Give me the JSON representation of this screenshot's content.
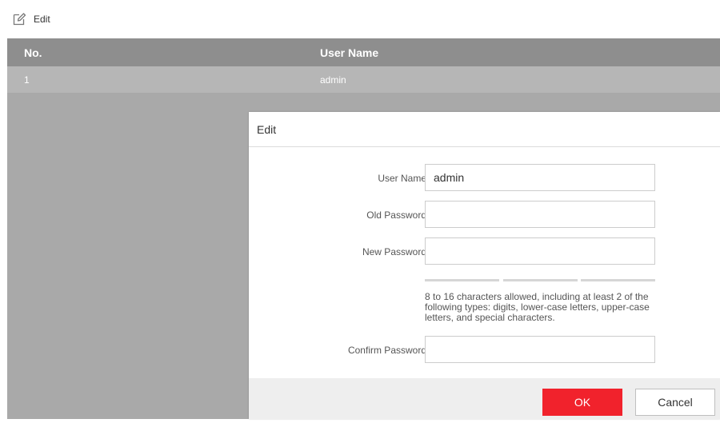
{
  "toolbar": {
    "edit_label": "Edit",
    "edit_icon": "edit-icon"
  },
  "table": {
    "columns": [
      "No.",
      "User Name"
    ],
    "rows": [
      [
        "1",
        "admin"
      ]
    ]
  },
  "dialog": {
    "title": "Edit",
    "fields": {
      "user_name": {
        "label": "User Name",
        "value": "admin"
      },
      "old_password": {
        "label": "Old Password",
        "value": ""
      },
      "new_password": {
        "label": "New Password",
        "value": ""
      },
      "confirm_password": {
        "label": "Confirm Password",
        "value": ""
      }
    },
    "password_hint": "8 to 16 characters allowed, including at least 2 of the following types: digits, lower-case letters, upper-case letters, and special characters.",
    "ok_label": "OK",
    "cancel_label": "Cancel"
  },
  "colors": {
    "accent": "#f1222c",
    "header_bg": "#8e8e8e",
    "overlay": "#a9a9a9"
  }
}
